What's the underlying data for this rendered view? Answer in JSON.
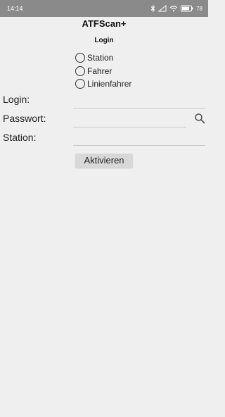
{
  "status_bar": {
    "time": "14:14",
    "battery": "78",
    "icons": [
      "bluetooth-icon",
      "signal-icon",
      "wifi-icon",
      "battery-icon"
    ]
  },
  "app": {
    "title": "ATFScan+"
  },
  "login_section": {
    "title": "Login",
    "radio_options": [
      {
        "label": "Station",
        "checked": false
      },
      {
        "label": "Fahrer",
        "checked": false
      },
      {
        "label": "Linienfahrer",
        "checked": false
      }
    ]
  },
  "form": {
    "login_label": "Login:",
    "login_value": "",
    "password_label": "Passwort:",
    "password_value": "",
    "station_label": "Station:",
    "station_value": "",
    "search_icon": "search-icon"
  },
  "actions": {
    "activate_label": "Aktivieren"
  },
  "colors": {
    "background": "#efefef",
    "status_bar": "#8a8a8a",
    "button": "#d8d8d8"
  }
}
